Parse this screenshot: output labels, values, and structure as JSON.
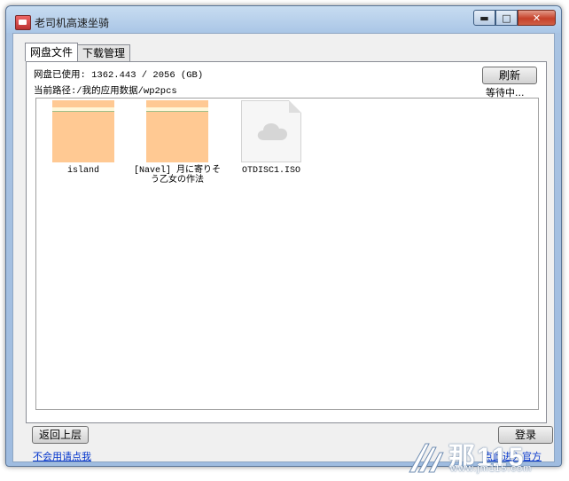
{
  "window": {
    "title": "老司机高速坐骑",
    "caption": {
      "minimize": "▬",
      "maximize": "□",
      "close": "✕"
    }
  },
  "tabs": [
    {
      "label": "网盘文件",
      "active": true
    },
    {
      "label": "下载管理",
      "active": false
    }
  ],
  "status": {
    "disk_usage": "网盘已使用: 1362.443 / 2056 (GB)",
    "current_path": "当前路径:/我的应用数据/wp2pcs",
    "waiting": "等待中..."
  },
  "toolbar": {
    "refresh_label": "刷新"
  },
  "files": [
    {
      "name": "island",
      "type": "folder",
      "icon": "folder-icon"
    },
    {
      "name": "[Navel] 月に寄りそう乙女の作法",
      "type": "folder",
      "icon": "folder-icon"
    },
    {
      "name": "OTDISC1.ISO",
      "type": "file",
      "icon": "cloud-file-icon"
    }
  ],
  "footer": {
    "back_label": "返回上层",
    "login_label": "登录",
    "help_link": "不会用请点我",
    "enter_link": "点此进入官方"
  },
  "watermark": {
    "brand": "那115",
    "url": "www.jm115.com"
  },
  "colors": {
    "folder": "#ffc993",
    "link": "#0033cc",
    "titlebar": "#aac6e6"
  }
}
